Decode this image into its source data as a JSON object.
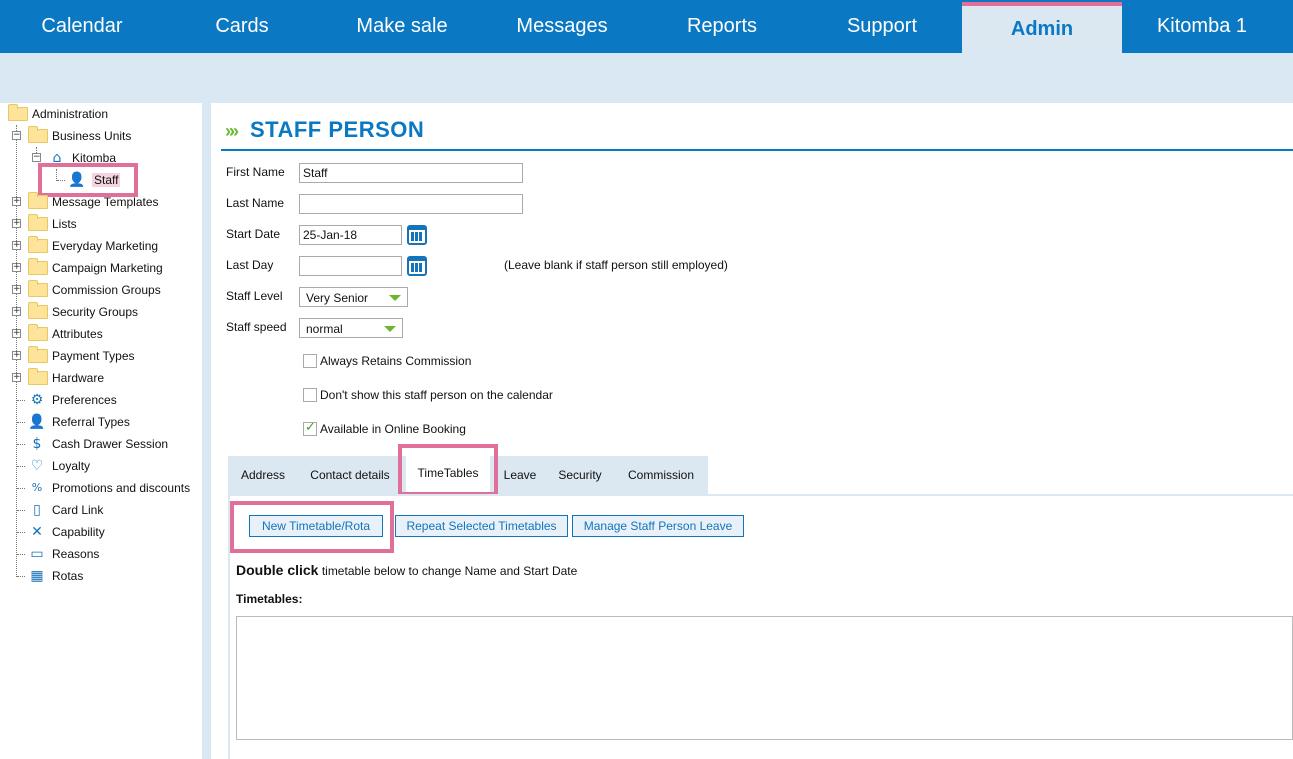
{
  "nav": {
    "tabs": [
      "Calendar",
      "Cards",
      "Make sale",
      "Messages",
      "Reports",
      "Support",
      "Admin",
      "Kitomba 1"
    ],
    "active": "Admin"
  },
  "tree": {
    "root": "Administration",
    "business_units": "Business Units",
    "kitomba": "Kitomba",
    "staff": "Staff",
    "items": [
      "Message Templates",
      "Lists",
      "Everyday Marketing",
      "Campaign Marketing",
      "Commission Groups",
      "Security Groups",
      "Attributes",
      "Payment Types",
      "Hardware"
    ],
    "leaf_items": [
      {
        "label": "Preferences",
        "icon": "gear-icon"
      },
      {
        "label": "Referral Types",
        "icon": "person-icon"
      },
      {
        "label": "Cash Drawer Session",
        "icon": "cash-drawer-icon"
      },
      {
        "label": "Loyalty",
        "icon": "heart-icon"
      },
      {
        "label": "Promotions and discounts",
        "icon": "percent-icon"
      },
      {
        "label": "Card Link",
        "icon": "card-link-icon"
      },
      {
        "label": "Capability",
        "icon": "tools-icon"
      },
      {
        "label": "Reasons",
        "icon": "speech-bubble-icon"
      },
      {
        "label": "Rotas",
        "icon": "calendar-icon"
      }
    ]
  },
  "page": {
    "title": "STAFF PERSON"
  },
  "form": {
    "first_name_label": "First Name",
    "first_name_value": "Staff",
    "last_name_label": "Last Name",
    "last_name_value": "",
    "start_date_label": "Start Date",
    "start_date_value": "25-Jan-18",
    "last_day_label": "Last Day",
    "last_day_value": "",
    "last_day_hint": "(Leave blank if staff person still employed)",
    "staff_level_label": "Staff Level",
    "staff_level_value": "Very Senior",
    "staff_speed_label": "Staff speed",
    "staff_speed_value": "normal",
    "always_retains_label": "Always Retains Commission",
    "always_retains_checked": false,
    "dont_show_label": "Don't show this staff person on the calendar",
    "dont_show_checked": false,
    "online_booking_label": "Available in Online Booking",
    "online_booking_checked": true
  },
  "tabs": {
    "items": [
      "Address",
      "Contact details",
      "TimeTables",
      "Leave",
      "Security",
      "Commission"
    ],
    "active": "TimeTables"
  },
  "timetables": {
    "new_btn": "New Timetable/Rota",
    "repeat_btn": "Repeat Selected Timetables",
    "leave_btn": "Manage Staff Person Leave",
    "hint_bold": "Double click",
    "hint_rest": "timetable below to change Name and Start Date",
    "list_label": "Timetables:"
  },
  "colors": {
    "brand_blue": "#0a78c2",
    "highlight_pink": "#e0709a",
    "accent_green": "#69b832"
  }
}
